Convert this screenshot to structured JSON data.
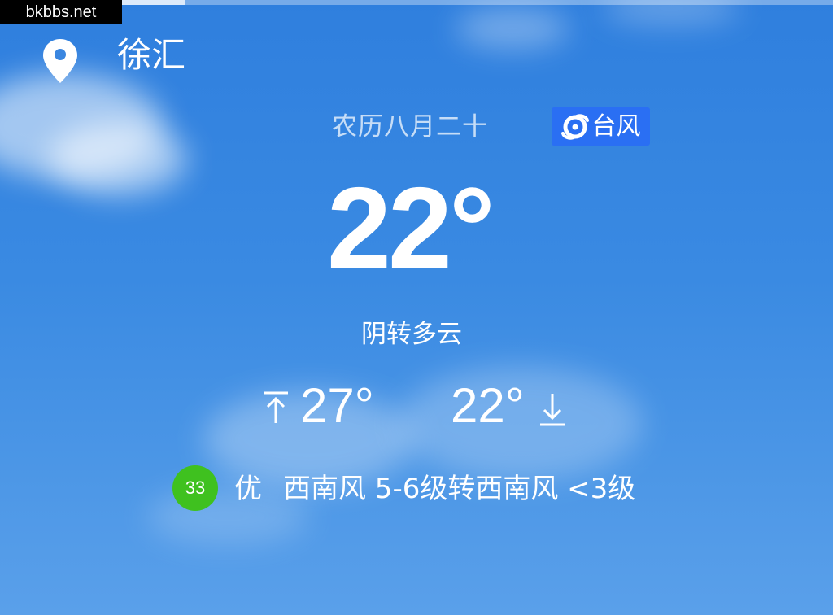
{
  "watermark": "bkbbs.net",
  "location": {
    "icon": "location-pin-icon",
    "city": "徐汇"
  },
  "lunar_date": "农历八月二十",
  "alert": {
    "icon": "typhoon-icon",
    "label": "台风",
    "color": "#2a6ff3"
  },
  "current": {
    "temperature": "22°",
    "condition": "阴转多云"
  },
  "forecast": {
    "high_icon": "arrow-up-icon",
    "high": "27°",
    "low": "22°",
    "low_icon": "arrow-down-icon"
  },
  "air_quality": {
    "aqi": "33",
    "level": "优",
    "color": "#3fc11f"
  },
  "wind": "西南风 5-6级转西南风 <3级"
}
